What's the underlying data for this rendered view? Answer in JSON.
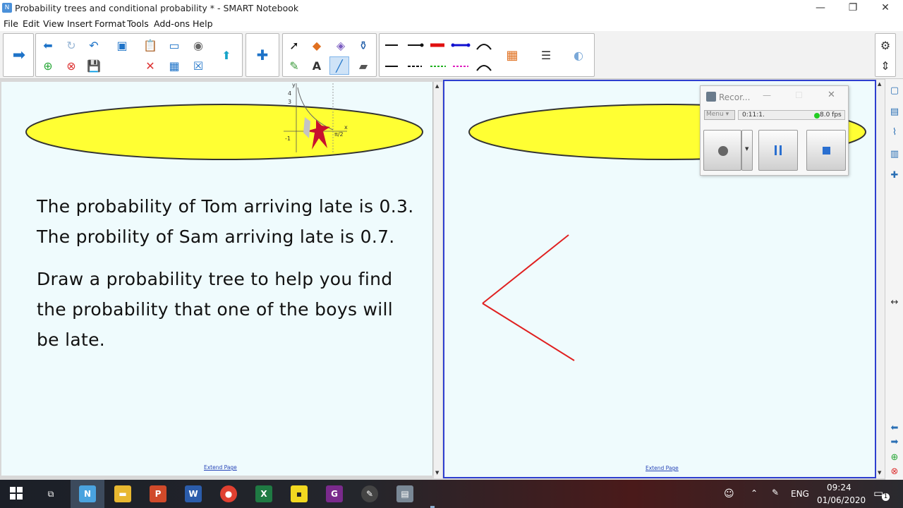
{
  "window": {
    "title": "Probability trees and conditional probability * - SMART Notebook",
    "minimize": "—",
    "restore": "❐",
    "close": "✕"
  },
  "menu": [
    "File",
    "Edit",
    "View",
    "Insert",
    "Format",
    "Tools",
    "Add-ons",
    "Help"
  ],
  "left_page": {
    "graph": {
      "y_label": "y",
      "y_tick_top": "4",
      "y_tick_mid": "3",
      "y_tick_bottom": "-1",
      "x_label": "x",
      "x_tick": "π/2"
    },
    "question_lines": [
      "The probability of Tom arriving late is 0.3.",
      "The probility of Sam arriving late is 0.7."
    ],
    "task_lines": [
      "Draw a probability tree to help you find",
      "the probability that one of the boys will",
      "be late."
    ],
    "extend_link": "Extend Page"
  },
  "right_page": {
    "extend_link": "Extend Page"
  },
  "recorder": {
    "title": "Recor...",
    "menu_label": "Menu",
    "time": "0:11:1.",
    "fps": "8.0 fps",
    "status_color": "#22cc22"
  },
  "taskbar": {
    "language": "ENG",
    "time": "09:24",
    "date": "01/06/2020",
    "notifications": "1"
  },
  "colors": {
    "ellipse_fill": "#ffff33",
    "tree_line": "#e02020",
    "page_bg": "#effbfd",
    "active_page_border": "#2e3fd0"
  }
}
